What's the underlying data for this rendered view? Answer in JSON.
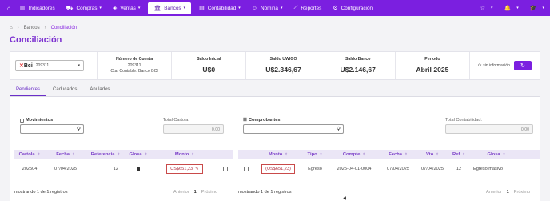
{
  "nav": {
    "items": [
      {
        "label": "Indicadores",
        "icon": "chart-bars-icon",
        "chev": ""
      },
      {
        "label": "Compras",
        "icon": "cart-icon",
        "chev": "▾"
      },
      {
        "label": "Ventas",
        "icon": "tag-icon",
        "chev": "▾"
      },
      {
        "label": "Bancos",
        "icon": "bank-icon",
        "chev": "▾"
      },
      {
        "label": "Contabilidad",
        "icon": "ledger-icon",
        "chev": "▾"
      },
      {
        "label": "Nómina",
        "icon": "people-icon",
        "chev": "▾"
      },
      {
        "label": "Reportes",
        "icon": "trend-icon",
        "chev": ""
      },
      {
        "label": "Configuración",
        "icon": "gear-icon",
        "chev": ""
      }
    ],
    "active_index": 3
  },
  "breadcrumb": {
    "level1": "Bancos",
    "level2": "Conciliación"
  },
  "page": {
    "title": "Conciliación"
  },
  "summary": {
    "bank": {
      "logo_x": "✕",
      "logo_name": "Bci",
      "account": "209311"
    },
    "cuenta": {
      "label": "Número de Cuenta",
      "number": "209311",
      "contable": "Cta. Contable: Banco BCI"
    },
    "saldo_inicial": {
      "label": "Saldo Inicial",
      "value": "U$0"
    },
    "saldo_uwigo": {
      "label": "Saldo UWIGO",
      "value": "U$2.346,67"
    },
    "saldo_banco": {
      "label": "Saldo Banco",
      "value": "U$2.146,67"
    },
    "periodo": {
      "label": "Periodo",
      "value": "Abril 2025"
    },
    "sin_info": "sin información"
  },
  "tabs": [
    "Pendientes",
    "Caducados",
    "Anulados"
  ],
  "left": {
    "search_label": "Movimientos",
    "total_label": "Total Cartola:",
    "total_value": "0.00",
    "headers": [
      "Cartola",
      "Fecha",
      "Referencia",
      "Glosa",
      "Monto"
    ],
    "row": {
      "cartola": "202504",
      "fecha": "07/04/2025",
      "referencia": "12",
      "monto": "US$651,23"
    },
    "footer": "mostrando 1 de 1 registros",
    "pager": {
      "prev": "Anterior",
      "page": "1",
      "next": "Próximo"
    }
  },
  "right": {
    "search_label": "Comprobantes",
    "total_label": "Total Contabilidad:",
    "total_value": "0.00",
    "headers": [
      "Monto",
      "Tipo",
      "Compte",
      "Fecha",
      "Vto",
      "Ref",
      "Glosa"
    ],
    "row": {
      "monto": "(US$651,23)",
      "tipo": "Egreso",
      "compte": "2025-04-01-0004",
      "fecha": "07/04/2025",
      "vto": "07/04/2025",
      "ref": "12",
      "glosa": "Egreso masivo"
    },
    "footer": "mostrando 1 de 1 registros",
    "pager": {
      "prev": "Anterior",
      "page": "1",
      "next": "Próximo"
    }
  }
}
